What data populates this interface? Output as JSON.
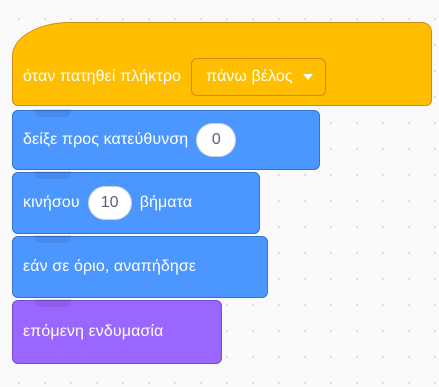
{
  "blocks": {
    "hat": {
      "label": "όταν πατηθεί πλήκτρο",
      "dropdown_value": "πάνω βέλος"
    },
    "point_direction": {
      "label": "δείξε προς κατεύθυνση",
      "value": "0"
    },
    "move": {
      "label_before": "κινήσου",
      "value": "10",
      "label_after": "βήματα"
    },
    "bounce": {
      "label": "εάν σε όριο, αναπήδησε"
    },
    "next_costume": {
      "label": "επόμενη ενδυμασία"
    }
  },
  "colors": {
    "events": "#ffbf00",
    "motion": "#4c97ff",
    "looks": "#9966ff",
    "workspace": "#f9f9f9"
  },
  "icons": {
    "dropdown": "triangle-down-icon"
  }
}
